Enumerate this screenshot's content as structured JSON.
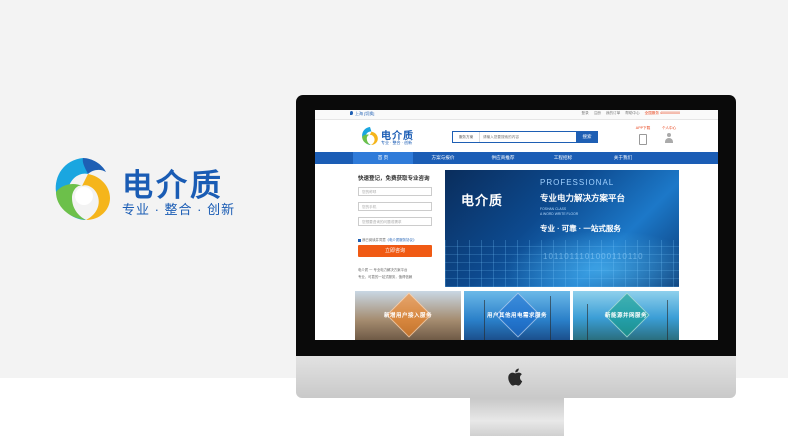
{
  "brand": {
    "name": "电介质",
    "tagline": "专业 · 整合 · 创新"
  },
  "site": {
    "topbar": {
      "city": "上海 [切换]",
      "links": [
        "登录",
        "注册",
        "我的订单",
        "帮助中心",
        "全国服务 4000000000"
      ]
    },
    "logo": {
      "name": "电介质",
      "tagline": "专业 · 整合 · 创新"
    },
    "search": {
      "category": "服务方案",
      "placeholder": "请输入您要搜索的内容",
      "button": "搜索"
    },
    "header_links": {
      "app": "APP下载",
      "user": "个人中心"
    },
    "nav": [
      "首 页",
      "方案与报价",
      "供应商推荐",
      "工程招标",
      "关于我们"
    ],
    "form": {
      "title": "快速登记，免费获取专业咨询",
      "fields": [
        "您的称呼",
        "您的手机",
        "您想要咨询的问题或需求"
      ],
      "agree_text": "我已阅读并同意",
      "agree_link": "《电介质服务协议》",
      "submit": "立即咨询",
      "notes": [
        "电介质 一 专业电力解决方案平台",
        "专业、可靠的一站式服务，值得信赖"
      ]
    },
    "banner": {
      "brand": "电介质",
      "professional": "PROFESSIONAL",
      "title": "专业电力解决方案平台",
      "sub1": "FOSHAN CLASS",
      "sub2": "A WORD WRITE FLOOR",
      "slogan": "专业 · 可靠 · 一站式服务",
      "binary": "1011011101000110110"
    },
    "cards": [
      "新增用户接入服务",
      "用户其他用电需求服务",
      "新能源并网服务"
    ]
  },
  "colors": {
    "brand_blue": "#1a5cb4",
    "nav_blue": "#1b5db5",
    "accent_orange": "#f05a14"
  }
}
